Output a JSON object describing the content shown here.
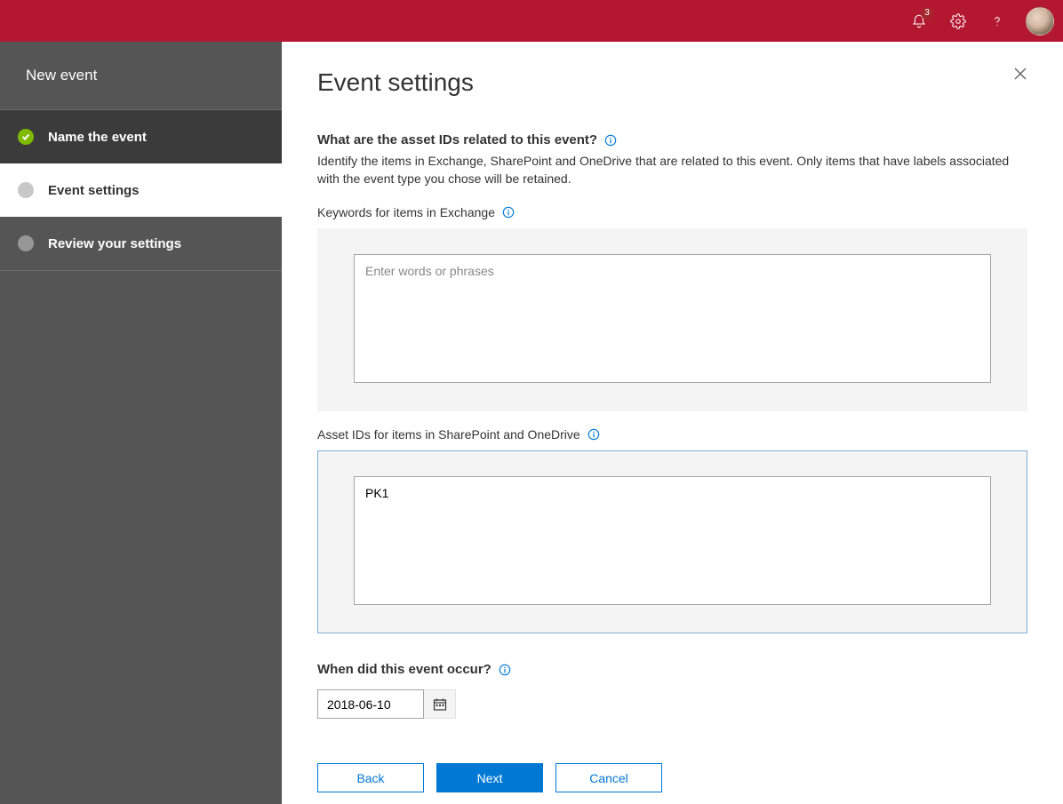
{
  "topbar": {
    "notification_count": "3"
  },
  "sidebar": {
    "header": "New event",
    "steps": [
      {
        "label": "Name the event"
      },
      {
        "label": "Event settings"
      },
      {
        "label": "Review your settings"
      }
    ]
  },
  "main": {
    "title": "Event settings",
    "section_q": "What are the asset IDs related to this event?",
    "section_desc": "Identify the items in Exchange, SharePoint and OneDrive that are related to this event. Only items that have labels associated with the event type you chose will be retained.",
    "keywords_label": "Keywords for items in Exchange",
    "keywords_placeholder": "Enter words or phrases",
    "keywords_value": "",
    "assetids_label": "Asset IDs for items in SharePoint and OneDrive",
    "assetids_value": "PK1",
    "when_label": "When did this event occur?",
    "date_value": "2018-06-10",
    "buttons": {
      "back": "Back",
      "next": "Next",
      "cancel": "Cancel"
    }
  }
}
